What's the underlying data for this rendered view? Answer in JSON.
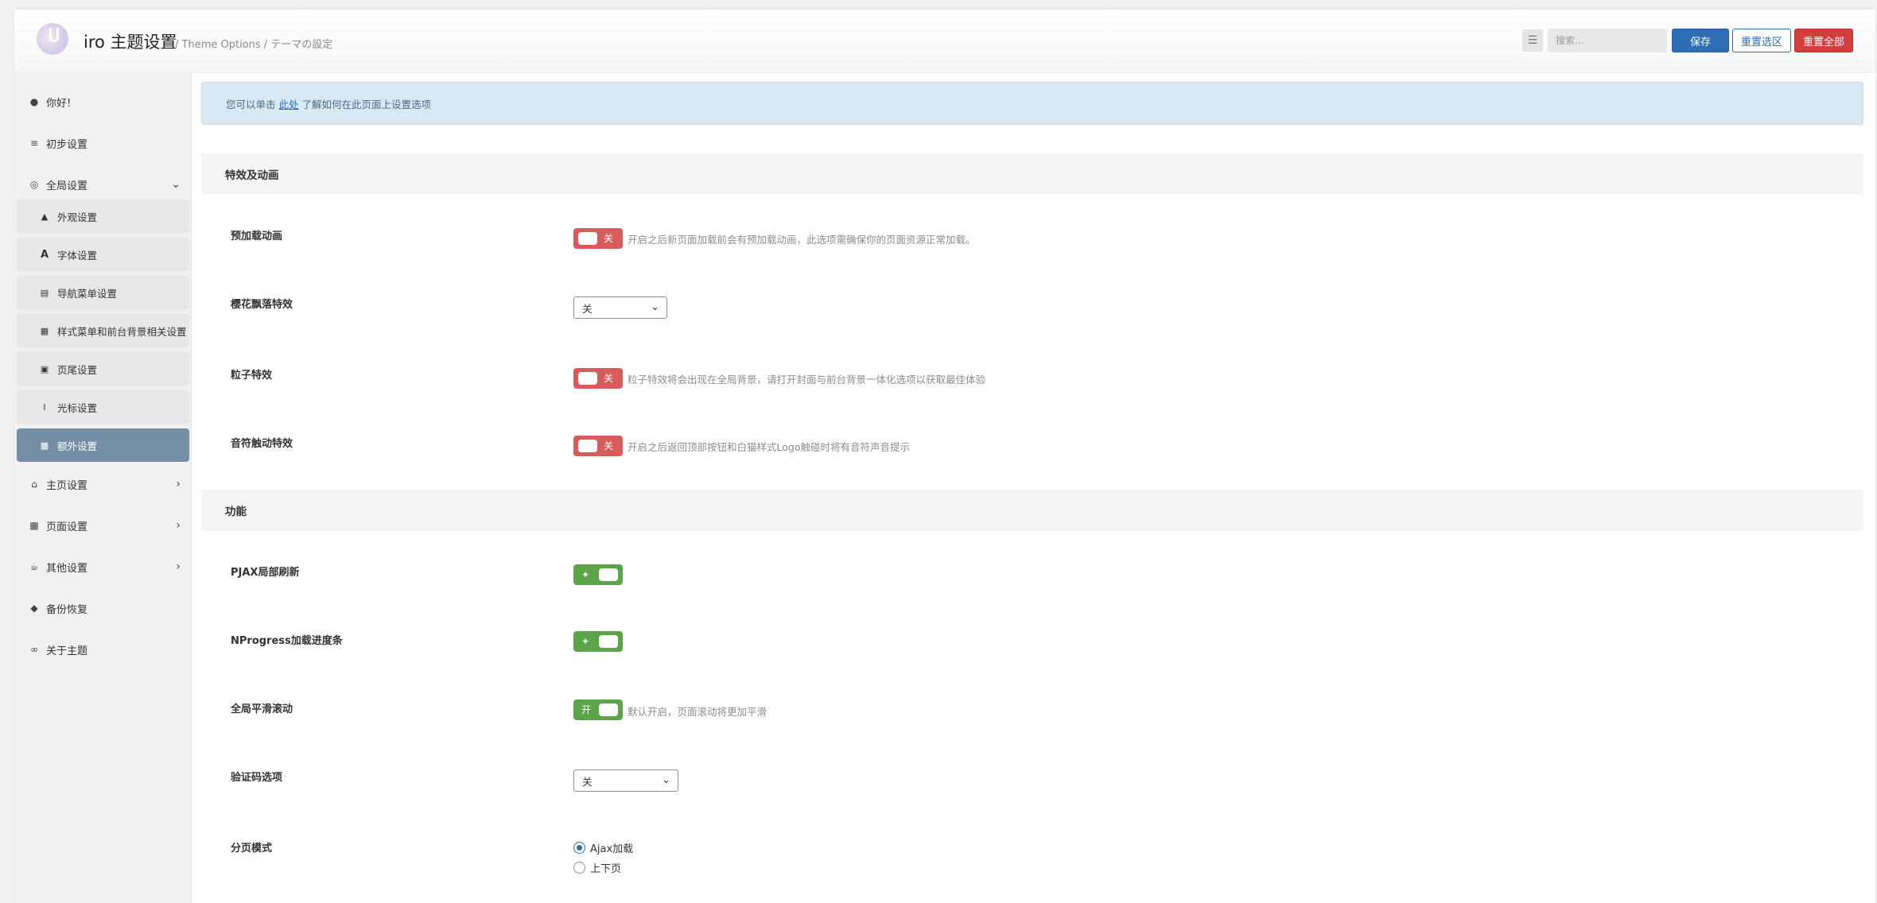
{
  "header": {
    "title": "iro 主题设置",
    "subtitle": "/ Theme Options / テーマの設定",
    "search_placeholder": "搜索...",
    "save_label": "保存",
    "reset_section_label": "重置选区",
    "reset_all_label": "重置全部"
  },
  "sidebar": {
    "items": [
      {
        "label": "你好!",
        "icon": "bulb-icon"
      },
      {
        "label": "初步设置",
        "icon": "sliders-icon"
      },
      {
        "label": "全局设置",
        "icon": "globe-icon"
      },
      {
        "label": "主页设置",
        "icon": "home-icon"
      },
      {
        "label": "页面设置",
        "icon": "file-icon"
      },
      {
        "label": "其他设置",
        "icon": "coffee-icon"
      },
      {
        "label": "备份恢复",
        "icon": "shield-icon"
      },
      {
        "label": "关于主题",
        "icon": "paperclip-icon"
      }
    ],
    "sub_items": [
      {
        "label": "外观设置",
        "icon": "bell-icon"
      },
      {
        "label": "字体设置",
        "icon": "font-icon"
      },
      {
        "label": "导航菜单设置",
        "icon": "signpost-icon"
      },
      {
        "label": "样式菜单和前台背景相关设置",
        "icon": "grid-icon"
      },
      {
        "label": "页尾设置",
        "icon": "square-icon"
      },
      {
        "label": "光标设置",
        "icon": "i-cursor-icon"
      },
      {
        "label": "额外设置",
        "icon": "gift-icon"
      }
    ]
  },
  "notice": {
    "prefix": "您可以单击",
    "link": "此处",
    "suffix": "了解如何在此页面上设置选项"
  },
  "sections": {
    "effects_title": "特效及动画",
    "features_title": "功能"
  },
  "fields": {
    "preload": {
      "label": "预加载动画",
      "state": "关",
      "desc": "开启之后新页面加载前会有预加载动画，此选项需确保你的页面资源正常加载。"
    },
    "sakura": {
      "label": "樱花飘落特效",
      "value": "关"
    },
    "particles": {
      "label": "粒子特效",
      "state": "关",
      "desc": "粒子特效将会出现在全局背景，请打开封面与前台背景一体化选项以获取最佳体验"
    },
    "music_note": {
      "label": "音符触动特效",
      "state": "关",
      "desc": "开启之后返回顶部按钮和白猫样式Logo触碰时将有音符声音提示"
    },
    "pjax": {
      "label": "PJAX局部刷新",
      "state_icon": "sparkle-icon"
    },
    "nprogress": {
      "label": "NProgress加载进度条",
      "state_icon": "sparkle-icon"
    },
    "smooth_scroll": {
      "label": "全局平滑滚动",
      "state": "开",
      "desc": "默认开启，页面滚动将更加平滑"
    },
    "captcha": {
      "label": "验证码选项",
      "value": "关"
    },
    "pagination": {
      "label": "分页模式",
      "options": [
        "Ajax加载",
        "上下页"
      ],
      "selected": "Ajax加载"
    }
  },
  "colors": {
    "primary": "#2f6eb6",
    "danger": "#d33d3d",
    "toggle_off": "#d85c5c",
    "toggle_on": "#5ba548",
    "active_nav": "#748fa5"
  }
}
